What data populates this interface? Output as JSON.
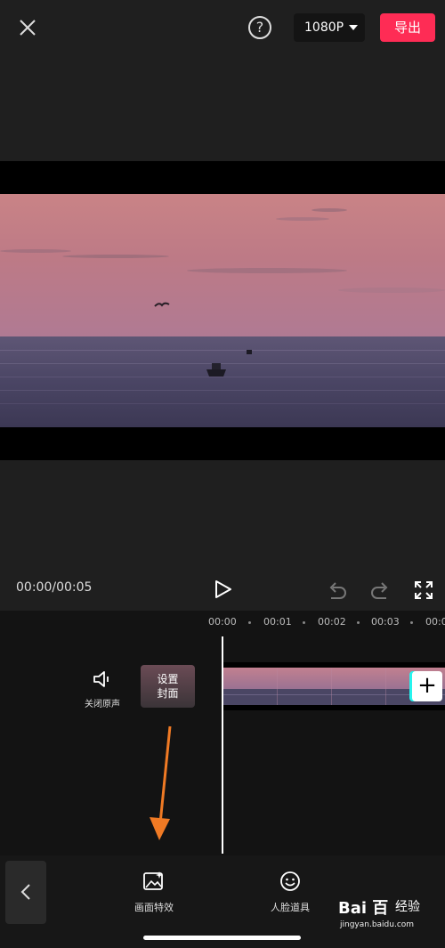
{
  "header": {
    "help_symbol": "?",
    "resolution": "1080P",
    "export_label": "导出"
  },
  "player": {
    "timecode": "00:00/00:05"
  },
  "timeline": {
    "ruler": [
      "00:00",
      "00:01",
      "00:02",
      "00:03",
      "00:0"
    ],
    "mute_label": "关闭原声",
    "cover_line1": "设置",
    "cover_line2": "封面",
    "add_symbol": "+"
  },
  "toolbar": {
    "items": [
      {
        "label": "画面特效",
        "icon": "image-sparkle-icon"
      },
      {
        "label": "人脸道具",
        "icon": "face-icon"
      }
    ]
  },
  "watermark": {
    "brand": "Bai 百",
    "jingyan": "经验",
    "url": "jingyan.baidu.com"
  },
  "colors": {
    "accent": "#fe2c55",
    "background": "#1f1f1f",
    "timeline_bg": "#131313"
  }
}
